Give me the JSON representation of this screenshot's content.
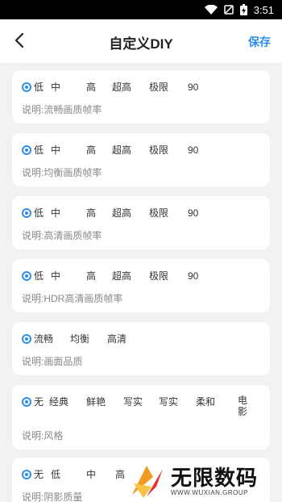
{
  "statusbar": {
    "time": "3:51",
    "icons": [
      "wifi-icon",
      "no-sim-icon",
      "battery-charging-icon"
    ]
  },
  "header": {
    "title": "自定义DIY",
    "save_label": "保存"
  },
  "accent": "#2e8ef0",
  "cards": [
    {
      "options": [
        "低",
        "中",
        "高",
        "超高",
        "极限",
        "90"
      ],
      "selected": "低",
      "description": "说明:流畅画质帧率"
    },
    {
      "options": [
        "低",
        "中",
        "高",
        "超高",
        "极限",
        "90"
      ],
      "selected": "低",
      "description": "说明:均衡画质帧率"
    },
    {
      "options": [
        "低",
        "中",
        "高",
        "超高",
        "极限",
        "90"
      ],
      "selected": "低",
      "description": "说明:高清画质帧率"
    },
    {
      "options": [
        "低",
        "中",
        "高",
        "超高",
        "极限",
        "90"
      ],
      "selected": "低",
      "description": "说明:HDR高清画质帧率"
    },
    {
      "options": [
        "流畅",
        "均衡",
        "高清"
      ],
      "selected": "流畅",
      "description": "说明:画面品质"
    },
    {
      "options": [
        "无",
        "经典",
        "鲜艳",
        "写实",
        "写实",
        "柔和",
        "电影"
      ],
      "selected": "无",
      "description": "说明:风格"
    },
    {
      "options": [
        "无",
        "低",
        "中",
        "高"
      ],
      "selected": "无",
      "description": "说明:阴影质量"
    }
  ],
  "watermark": {
    "brand": "无限数码",
    "url": "WWW.WUXIAN.GROUP"
  }
}
